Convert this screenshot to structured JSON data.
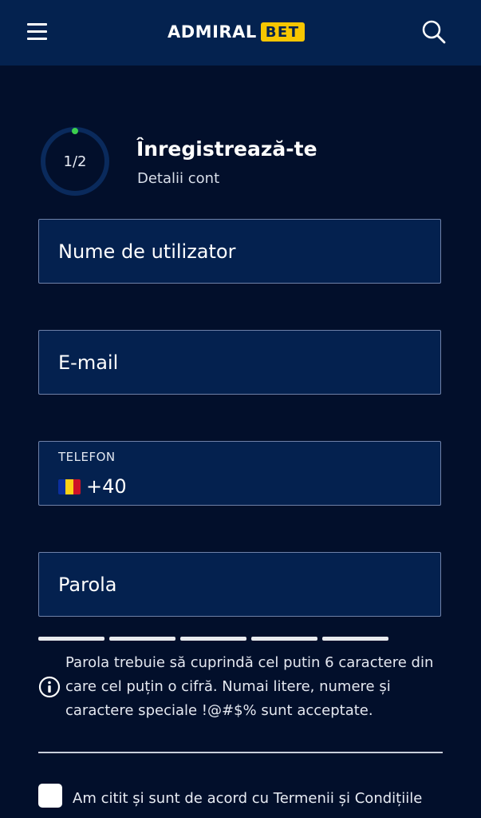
{
  "header": {
    "logo_text": "ADMIRAL",
    "logo_badge": "BET"
  },
  "progress": {
    "step_label": "1/2",
    "fraction": 0.5
  },
  "registration": {
    "title": "Înregistrează-te",
    "subtitle": "Detalii cont"
  },
  "form": {
    "username_placeholder": "Nume de utilizator",
    "email_placeholder": "E-mail",
    "phone_label": "TELEFON",
    "phone_prefix": "+40",
    "password_placeholder": "Parola",
    "password_hint": "Parola trebuie să cuprindă cel putin 6 caractere din care cel puțin o cifră. Numai litere, numere și caractere speciale !@#$% sunt acceptate."
  },
  "terms": {
    "text": "Am citit și sunt de acord cu Termenii și Condițiile",
    "link_text": "Termenii și Condițiile"
  },
  "colors": {
    "background": "#020f2b",
    "header": "#04224f",
    "accent_yellow": "#f7c600",
    "progress_dot": "#3ccf4e"
  }
}
